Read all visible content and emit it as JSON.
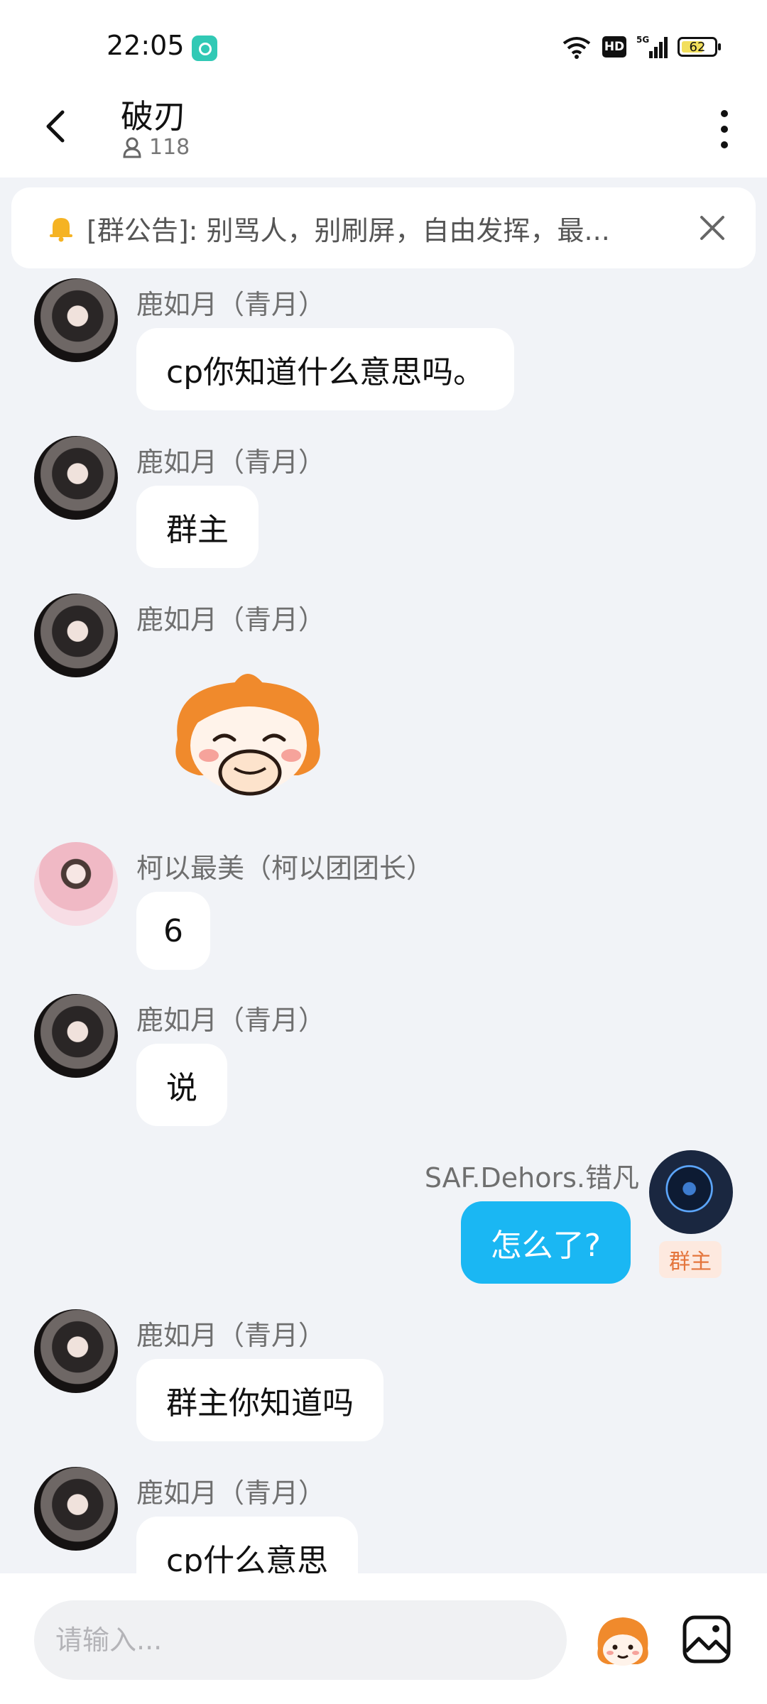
{
  "status_bar": {
    "time": "22:05",
    "network_badge": "HD",
    "cell_label": "5G",
    "battery": "62"
  },
  "header": {
    "title": "破刃",
    "member_count": "118"
  },
  "notice": {
    "text": "[群公告]: 别骂人，别刷屏，自由发挥，最..."
  },
  "messages": [
    {
      "sender": "鹿如月（青月）",
      "text": "cp你知道什么意思吗。"
    },
    {
      "sender": "鹿如月（青月）",
      "text": "群主"
    },
    {
      "sender": "鹿如月（青月）",
      "sticker": "anime-face-sticker"
    },
    {
      "sender": "柯以最美（柯以团团长）",
      "text": "6"
    },
    {
      "sender": "鹿如月（青月）",
      "text": "说"
    },
    {
      "sender": "SAF.Dehors.错凡",
      "text": "怎么了?",
      "role": "群主",
      "mine": true
    },
    {
      "sender": "鹿如月（青月）",
      "text": "群主你知道吗"
    },
    {
      "sender": "鹿如月（青月）",
      "text": "cp什么意思"
    }
  ],
  "composer": {
    "placeholder": "请输入..."
  },
  "colors": {
    "accent": "#1ab7f3",
    "background": "#f1f3f7",
    "owner_badge": "#e4753c"
  }
}
